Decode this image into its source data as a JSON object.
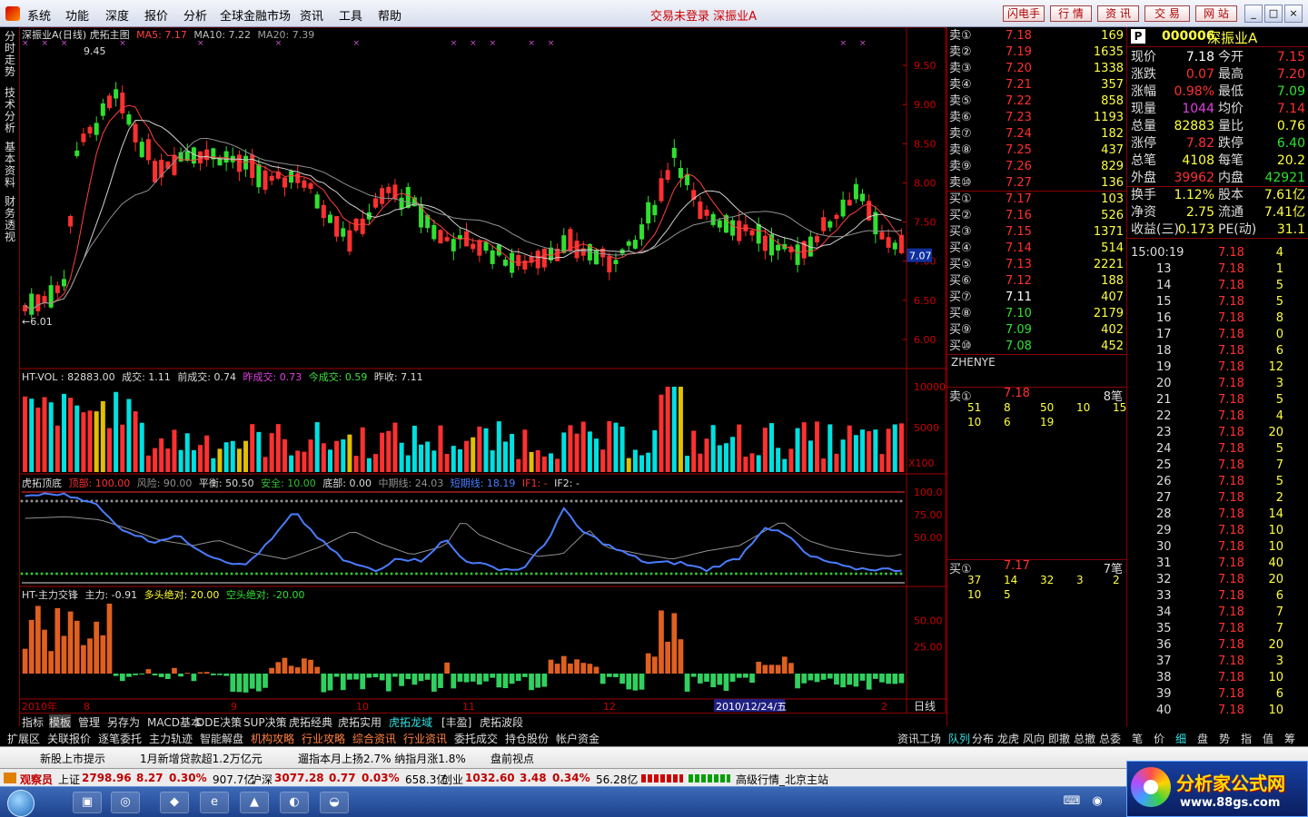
{
  "menu": {
    "items": [
      "系统",
      "功能",
      "深度",
      "报价",
      "分析",
      "全球金融市场",
      "资讯",
      "工具",
      "帮助"
    ],
    "status": "交易未登录  深振业A",
    "buttons": [
      "闪电手",
      "行 情",
      "资 讯",
      "交 易",
      "网 站"
    ],
    "window_controls": [
      "_",
      "□",
      "×"
    ]
  },
  "left_tabs": [
    "分时走势",
    "技术分析",
    "基本资料",
    "财务透视"
  ],
  "main_chart": {
    "title": "深振业A(日线) 虎拓主图",
    "ma5": "MA5: 7.17",
    "ma10": "MA10: 7.22",
    "ma20": "MA20: 7.39",
    "high_label": "9.45",
    "low_label": "←6.01",
    "price_ticks": [
      "9.50",
      "9.00",
      "8.50",
      "8.00",
      "7.50",
      "7.00",
      "6.50",
      "6.00"
    ],
    "current_price_tag": "7.07"
  },
  "vol_panel": {
    "header": [
      "HT-VOL : 82883.00",
      "成交: 1.11",
      "前成交: 0.74",
      "昨成交: 0.73",
      "今成交: 0.59",
      "昨收: 7.11"
    ],
    "ticks": [
      "10000",
      "5000"
    ],
    "unit": "X100"
  },
  "osc_panel": {
    "header": [
      "虎拓顶底",
      "顶部: 100.00",
      "风险: 90.00",
      "平衡: 50.50",
      "安全: 10.00",
      "底部: 0.00",
      "中期线: 24.03",
      "短期线: 18.19",
      "IF1: -",
      "IF2: -"
    ],
    "ticks": [
      "100.0",
      "75.00",
      "50.00"
    ]
  },
  "force_panel": {
    "header": [
      "HT-主力交锋",
      "主力: -0.91",
      "多头绝对: 20.00",
      "空头绝对: -20.00"
    ],
    "ticks": [
      "50.00",
      "25.00"
    ]
  },
  "xaxis": {
    "labels": [
      "2010年",
      "8",
      "9",
      "10",
      "11",
      "12",
      "2010/12/24/五",
      "2"
    ],
    "period": "日线"
  },
  "chart_tabs": [
    "指标",
    "模板",
    "管理",
    "另存为",
    "MACD基本",
    "DDE决策",
    "SUP决策",
    "虎拓经典",
    "虎拓实用",
    "虎拓龙域",
    "[丰盈]",
    "虎拓波段"
  ],
  "bottom_tabs": [
    "扩展区",
    "关联报价",
    "逐笔委托",
    "主力轨迹",
    "智能解盘",
    "机构攻略",
    "行业攻略",
    "综合资讯",
    "行业资讯",
    "委托成交",
    "持仓股份",
    "帐户资金"
  ],
  "bottom_tabs_right": [
    "资讯工场",
    "队列",
    "分布",
    "龙虎",
    "风向",
    "即撤",
    "总撤",
    "总委"
  ],
  "tick_tabs": [
    "笔",
    "价",
    "细",
    "盘",
    "势",
    "指",
    "值",
    "筹"
  ],
  "sells": [
    {
      "label": "卖⑩",
      "price": "7.27",
      "vol": "136"
    },
    {
      "label": "卖⑨",
      "price": "7.26",
      "vol": "829"
    },
    {
      "label": "卖⑧",
      "price": "7.25",
      "vol": "437"
    },
    {
      "label": "卖⑦",
      "price": "7.24",
      "vol": "182"
    },
    {
      "label": "卖⑥",
      "price": "7.23",
      "vol": "1193"
    },
    {
      "label": "卖⑤",
      "price": "7.22",
      "vol": "858"
    },
    {
      "label": "卖④",
      "price": "7.21",
      "vol": "357"
    },
    {
      "label": "卖③",
      "price": "7.20",
      "vol": "1338"
    },
    {
      "label": "卖②",
      "price": "7.19",
      "vol": "1635"
    },
    {
      "label": "卖①",
      "price": "7.18",
      "vol": "169"
    }
  ],
  "buys": [
    {
      "label": "买①",
      "price": "7.17",
      "vol": "103"
    },
    {
      "label": "买②",
      "price": "7.16",
      "vol": "526"
    },
    {
      "label": "买③",
      "price": "7.15",
      "vol": "1371"
    },
    {
      "label": "买④",
      "price": "7.14",
      "vol": "514"
    },
    {
      "label": "买⑤",
      "price": "7.13",
      "vol": "2221"
    },
    {
      "label": "买⑥",
      "price": "7.12",
      "vol": "188"
    },
    {
      "label": "买⑦",
      "price": "7.11",
      "vol": "407"
    },
    {
      "label": "买⑧",
      "price": "7.10",
      "vol": "2179"
    },
    {
      "label": "买⑨",
      "price": "7.09",
      "vol": "402"
    },
    {
      "label": "买⑩",
      "price": "7.08",
      "vol": "452"
    }
  ],
  "queue": {
    "broker": "ZHENYE",
    "sell_label": "卖①",
    "sell_price": "7.18",
    "sell_count": "8笔",
    "sell_orders": [
      "51",
      "8",
      "50",
      "10",
      "15",
      "10",
      "6",
      "19"
    ],
    "buy_label": "买①",
    "buy_price": "7.17",
    "buy_count": "7笔",
    "buy_orders": [
      "37",
      "14",
      "32",
      "3",
      "2",
      "10",
      "5"
    ]
  },
  "stock": {
    "badge": "P",
    "code": "000006",
    "name": "深振业A"
  },
  "info": [
    {
      "l1": "现价",
      "v1": "7.18",
      "l2": "今开",
      "v2": "7.15"
    },
    {
      "l1": "涨跌",
      "v1": "0.07",
      "l2": "最高",
      "v2": "7.20"
    },
    {
      "l1": "涨幅",
      "v1": "0.98%",
      "l2": "最低",
      "v2": "7.09"
    },
    {
      "l1": "现量",
      "v1": "1044",
      "l2": "均价",
      "v2": "7.14"
    },
    {
      "l1": "总量",
      "v1": "82883",
      "l2": "量比",
      "v2": "0.76"
    },
    {
      "l1": "涨停",
      "v1": "7.82",
      "l2": "跌停",
      "v2": "6.40"
    },
    {
      "l1": "总笔",
      "v1": "4108",
      "l2": "每笔",
      "v2": "20.2"
    },
    {
      "l1": "外盘",
      "v1": "39962",
      "l2": "内盘",
      "v2": "42921"
    },
    {
      "l1": "换手",
      "v1": "1.12%",
      "l2": "股本",
      "v2": "7.61亿"
    },
    {
      "l1": "净资",
      "v1": "2.75",
      "l2": "流通",
      "v2": "7.41亿"
    },
    {
      "l1": "收益(三)",
      "v1": "0.173",
      "l2": "PE(动)",
      "v2": "31.1"
    }
  ],
  "ticks": [
    {
      "t": "15:00:19",
      "p": "7.18",
      "v": "4"
    },
    {
      "t": "13",
      "p": "7.18",
      "v": "1"
    },
    {
      "t": "14",
      "p": "7.18",
      "v": "5"
    },
    {
      "t": "15",
      "p": "7.18",
      "v": "5"
    },
    {
      "t": "16",
      "p": "7.18",
      "v": "8"
    },
    {
      "t": "17",
      "p": "7.18",
      "v": "0"
    },
    {
      "t": "18",
      "p": "7.18",
      "v": "6"
    },
    {
      "t": "19",
      "p": "7.18",
      "v": "12"
    },
    {
      "t": "20",
      "p": "7.18",
      "v": "3"
    },
    {
      "t": "21",
      "p": "7.18",
      "v": "5"
    },
    {
      "t": "22",
      "p": "7.18",
      "v": "4"
    },
    {
      "t": "23",
      "p": "7.18",
      "v": "20"
    },
    {
      "t": "24",
      "p": "7.18",
      "v": "5"
    },
    {
      "t": "25",
      "p": "7.18",
      "v": "7"
    },
    {
      "t": "26",
      "p": "7.18",
      "v": "5"
    },
    {
      "t": "27",
      "p": "7.18",
      "v": "2"
    },
    {
      "t": "28",
      "p": "7.18",
      "v": "14"
    },
    {
      "t": "29",
      "p": "7.18",
      "v": "10"
    },
    {
      "t": "30",
      "p": "7.18",
      "v": "10"
    },
    {
      "t": "31",
      "p": "7.18",
      "v": "40"
    },
    {
      "t": "32",
      "p": "7.18",
      "v": "20"
    },
    {
      "t": "33",
      "p": "7.18",
      "v": "6"
    },
    {
      "t": "34",
      "p": "7.18",
      "v": "7"
    },
    {
      "t": "35",
      "p": "7.18",
      "v": "7"
    },
    {
      "t": "36",
      "p": "7.18",
      "v": "20"
    },
    {
      "t": "37",
      "p": "7.18",
      "v": "3"
    },
    {
      "t": "38",
      "p": "7.18",
      "v": "10"
    },
    {
      "t": "39",
      "p": "7.18",
      "v": "6"
    },
    {
      "t": "40",
      "p": "7.18",
      "v": "10"
    }
  ],
  "news": [
    "新股上市提示",
    "1月新增贷款超1.2万亿元",
    "遛指本月上扬2.7% 纳指月涨1.8%",
    "盘前视点"
  ],
  "market": {
    "label": "观察员",
    "sh_name": "上证",
    "sh_val": "2798.96",
    "sh_chg": "8.27",
    "sh_pct": "0.30%",
    "sh_amt": "907.7亿",
    "sz_name": "沪深",
    "sz_val": "3077.28",
    "sz_chg": "0.77",
    "sz_pct": "0.03%",
    "sz_amt": "658.3亿",
    "cy_name": "创业",
    "cy_val": "1032.60",
    "cy_chg": "3.48",
    "cy_pct": "0.34%",
    "cy_amt": "56.28亿",
    "server": "高级行情_北京主站"
  },
  "brand": {
    "name": "分析家公式网",
    "url": "www.88gs.com"
  },
  "colors": {
    "up": "#ff3030",
    "down": "#00e0e0",
    "green": "#30e030",
    "yellow": "#ffff00",
    "blue": "#4a7cff"
  }
}
